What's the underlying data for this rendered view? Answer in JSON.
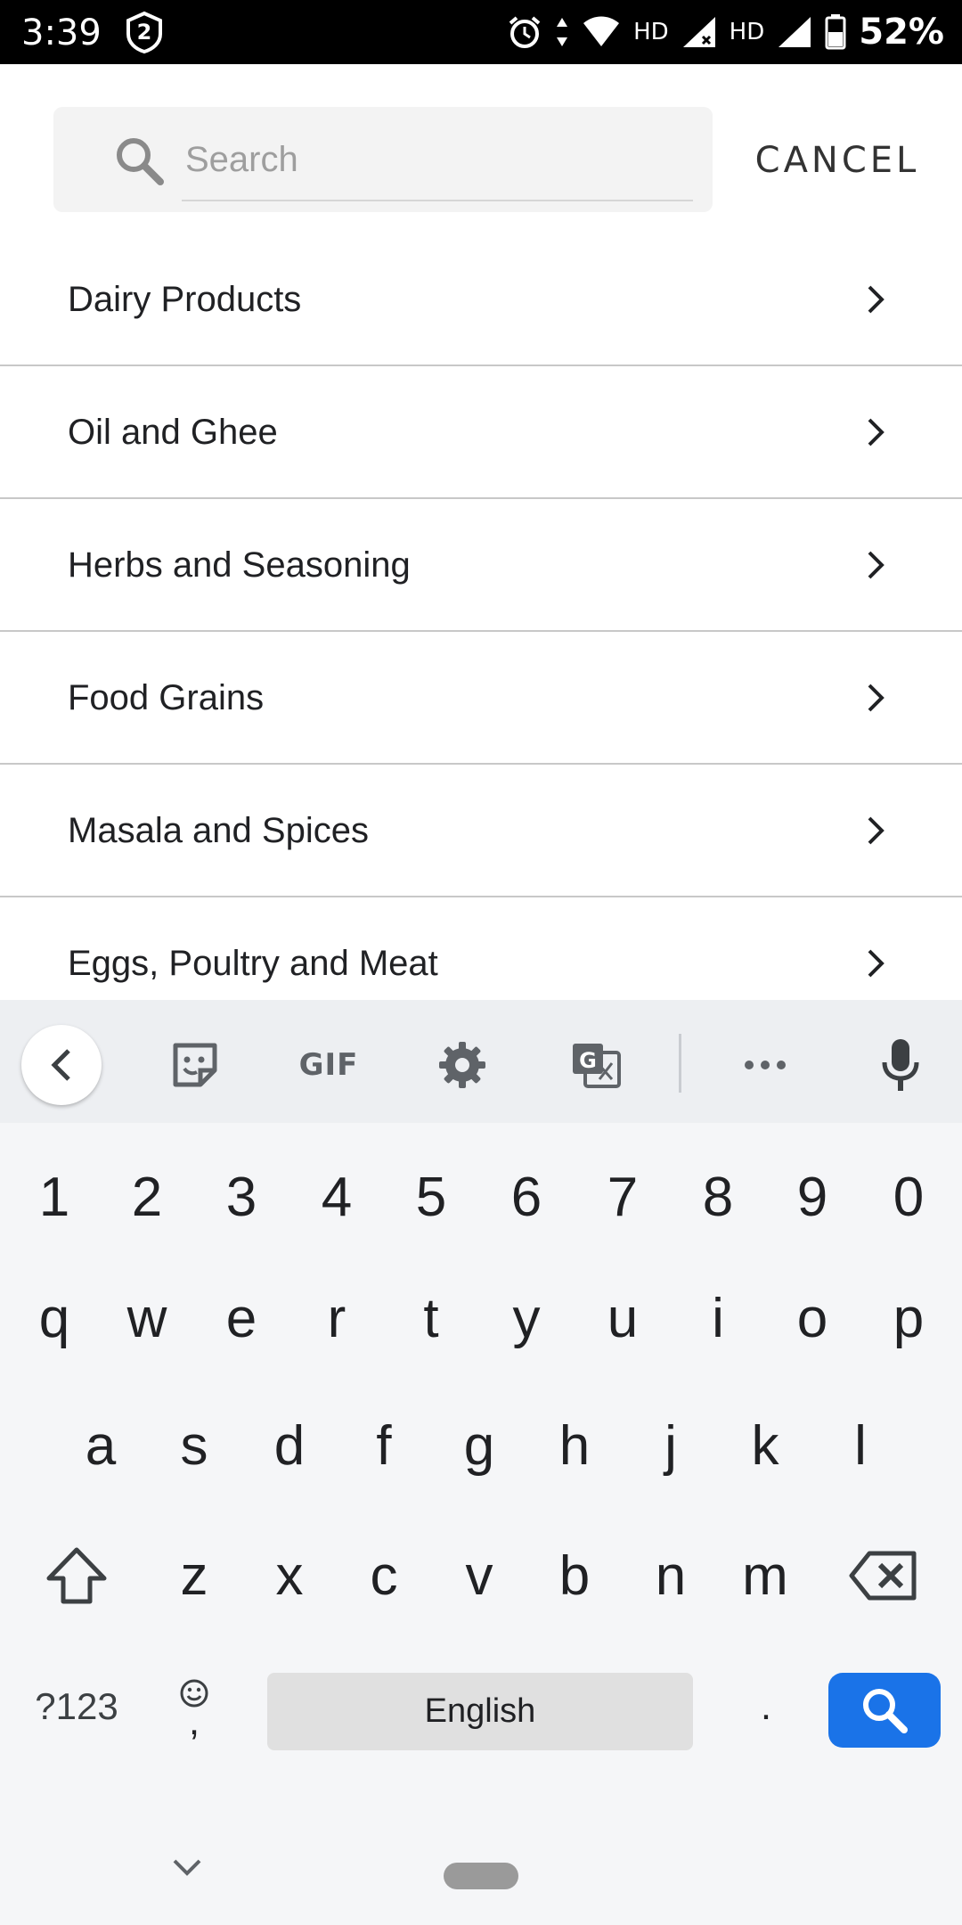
{
  "status_bar": {
    "time": "3:39",
    "notification_badge": "2",
    "hd_labels": [
      "HD",
      "HD"
    ],
    "battery": "52%"
  },
  "search": {
    "placeholder": "Search",
    "value": "",
    "cancel_label": "CANCEL"
  },
  "categories": [
    {
      "label": "Dairy Products"
    },
    {
      "label": "Oil and Ghee"
    },
    {
      "label": "Herbs and Seasoning"
    },
    {
      "label": "Food Grains"
    },
    {
      "label": "Masala and Spices"
    },
    {
      "label": "Eggs, Poultry and Meat"
    }
  ],
  "keyboard": {
    "toolbar": {
      "gif_label": "GIF"
    },
    "number_row": [
      "1",
      "2",
      "3",
      "4",
      "5",
      "6",
      "7",
      "8",
      "9",
      "0"
    ],
    "row1": [
      "q",
      "w",
      "e",
      "r",
      "t",
      "y",
      "u",
      "i",
      "o",
      "p"
    ],
    "row2": [
      "a",
      "s",
      "d",
      "f",
      "g",
      "h",
      "j",
      "k",
      "l"
    ],
    "row3": [
      "z",
      "x",
      "c",
      "v",
      "b",
      "n",
      "m"
    ],
    "symbols_label": "?123",
    "comma_label": ",",
    "space_label": "English",
    "period_label": ".",
    "accent_color": "#1a73e8"
  }
}
